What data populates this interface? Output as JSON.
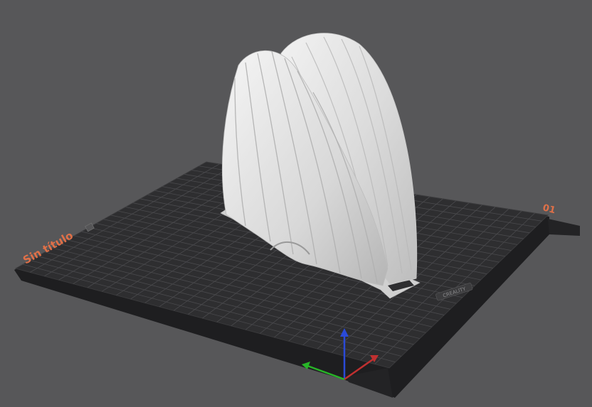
{
  "viewport": {
    "background_color": "#575759",
    "plate_color": "#2e2e30",
    "grid_color": "#4a4a4d",
    "accent_color": "#e07048",
    "model_color": "#e8e8e8"
  },
  "plate": {
    "name_label": "Sin título",
    "number_label": "01",
    "brand_label": "CREALITY"
  },
  "axes": {
    "x_color": "#c03030",
    "y_color": "#28b428",
    "z_color": "#2a4ad8"
  },
  "model": {
    "name": "scallop-shell-model"
  }
}
